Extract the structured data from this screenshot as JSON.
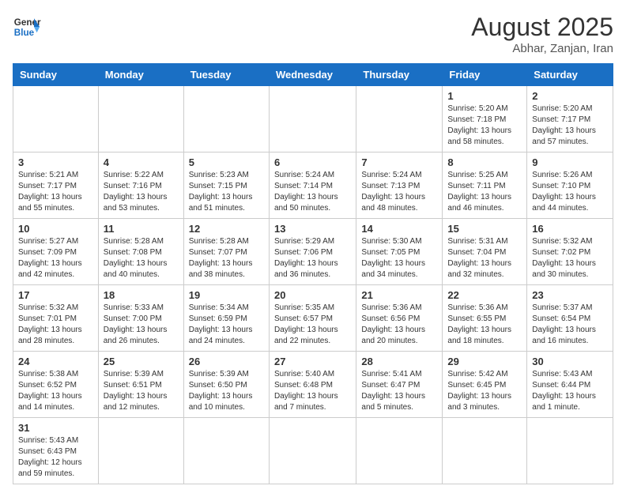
{
  "header": {
    "logo_general": "General",
    "logo_blue": "Blue",
    "month_year": "August 2025",
    "location": "Abhar, Zanjan, Iran"
  },
  "days_of_week": [
    "Sunday",
    "Monday",
    "Tuesday",
    "Wednesday",
    "Thursday",
    "Friday",
    "Saturday"
  ],
  "weeks": [
    [
      {
        "day": "",
        "info": ""
      },
      {
        "day": "",
        "info": ""
      },
      {
        "day": "",
        "info": ""
      },
      {
        "day": "",
        "info": ""
      },
      {
        "day": "",
        "info": ""
      },
      {
        "day": "1",
        "info": "Sunrise: 5:20 AM\nSunset: 7:18 PM\nDaylight: 13 hours and 58 minutes."
      },
      {
        "day": "2",
        "info": "Sunrise: 5:20 AM\nSunset: 7:17 PM\nDaylight: 13 hours and 57 minutes."
      }
    ],
    [
      {
        "day": "3",
        "info": "Sunrise: 5:21 AM\nSunset: 7:17 PM\nDaylight: 13 hours and 55 minutes."
      },
      {
        "day": "4",
        "info": "Sunrise: 5:22 AM\nSunset: 7:16 PM\nDaylight: 13 hours and 53 minutes."
      },
      {
        "day": "5",
        "info": "Sunrise: 5:23 AM\nSunset: 7:15 PM\nDaylight: 13 hours and 51 minutes."
      },
      {
        "day": "6",
        "info": "Sunrise: 5:24 AM\nSunset: 7:14 PM\nDaylight: 13 hours and 50 minutes."
      },
      {
        "day": "7",
        "info": "Sunrise: 5:24 AM\nSunset: 7:13 PM\nDaylight: 13 hours and 48 minutes."
      },
      {
        "day": "8",
        "info": "Sunrise: 5:25 AM\nSunset: 7:11 PM\nDaylight: 13 hours and 46 minutes."
      },
      {
        "day": "9",
        "info": "Sunrise: 5:26 AM\nSunset: 7:10 PM\nDaylight: 13 hours and 44 minutes."
      }
    ],
    [
      {
        "day": "10",
        "info": "Sunrise: 5:27 AM\nSunset: 7:09 PM\nDaylight: 13 hours and 42 minutes."
      },
      {
        "day": "11",
        "info": "Sunrise: 5:28 AM\nSunset: 7:08 PM\nDaylight: 13 hours and 40 minutes."
      },
      {
        "day": "12",
        "info": "Sunrise: 5:28 AM\nSunset: 7:07 PM\nDaylight: 13 hours and 38 minutes."
      },
      {
        "day": "13",
        "info": "Sunrise: 5:29 AM\nSunset: 7:06 PM\nDaylight: 13 hours and 36 minutes."
      },
      {
        "day": "14",
        "info": "Sunrise: 5:30 AM\nSunset: 7:05 PM\nDaylight: 13 hours and 34 minutes."
      },
      {
        "day": "15",
        "info": "Sunrise: 5:31 AM\nSunset: 7:04 PM\nDaylight: 13 hours and 32 minutes."
      },
      {
        "day": "16",
        "info": "Sunrise: 5:32 AM\nSunset: 7:02 PM\nDaylight: 13 hours and 30 minutes."
      }
    ],
    [
      {
        "day": "17",
        "info": "Sunrise: 5:32 AM\nSunset: 7:01 PM\nDaylight: 13 hours and 28 minutes."
      },
      {
        "day": "18",
        "info": "Sunrise: 5:33 AM\nSunset: 7:00 PM\nDaylight: 13 hours and 26 minutes."
      },
      {
        "day": "19",
        "info": "Sunrise: 5:34 AM\nSunset: 6:59 PM\nDaylight: 13 hours and 24 minutes."
      },
      {
        "day": "20",
        "info": "Sunrise: 5:35 AM\nSunset: 6:57 PM\nDaylight: 13 hours and 22 minutes."
      },
      {
        "day": "21",
        "info": "Sunrise: 5:36 AM\nSunset: 6:56 PM\nDaylight: 13 hours and 20 minutes."
      },
      {
        "day": "22",
        "info": "Sunrise: 5:36 AM\nSunset: 6:55 PM\nDaylight: 13 hours and 18 minutes."
      },
      {
        "day": "23",
        "info": "Sunrise: 5:37 AM\nSunset: 6:54 PM\nDaylight: 13 hours and 16 minutes."
      }
    ],
    [
      {
        "day": "24",
        "info": "Sunrise: 5:38 AM\nSunset: 6:52 PM\nDaylight: 13 hours and 14 minutes."
      },
      {
        "day": "25",
        "info": "Sunrise: 5:39 AM\nSunset: 6:51 PM\nDaylight: 13 hours and 12 minutes."
      },
      {
        "day": "26",
        "info": "Sunrise: 5:39 AM\nSunset: 6:50 PM\nDaylight: 13 hours and 10 minutes."
      },
      {
        "day": "27",
        "info": "Sunrise: 5:40 AM\nSunset: 6:48 PM\nDaylight: 13 hours and 7 minutes."
      },
      {
        "day": "28",
        "info": "Sunrise: 5:41 AM\nSunset: 6:47 PM\nDaylight: 13 hours and 5 minutes."
      },
      {
        "day": "29",
        "info": "Sunrise: 5:42 AM\nSunset: 6:45 PM\nDaylight: 13 hours and 3 minutes."
      },
      {
        "day": "30",
        "info": "Sunrise: 5:43 AM\nSunset: 6:44 PM\nDaylight: 13 hours and 1 minute."
      }
    ],
    [
      {
        "day": "31",
        "info": "Sunrise: 5:43 AM\nSunset: 6:43 PM\nDaylight: 12 hours and 59 minutes."
      },
      {
        "day": "",
        "info": ""
      },
      {
        "day": "",
        "info": ""
      },
      {
        "day": "",
        "info": ""
      },
      {
        "day": "",
        "info": ""
      },
      {
        "day": "",
        "info": ""
      },
      {
        "day": "",
        "info": ""
      }
    ]
  ]
}
